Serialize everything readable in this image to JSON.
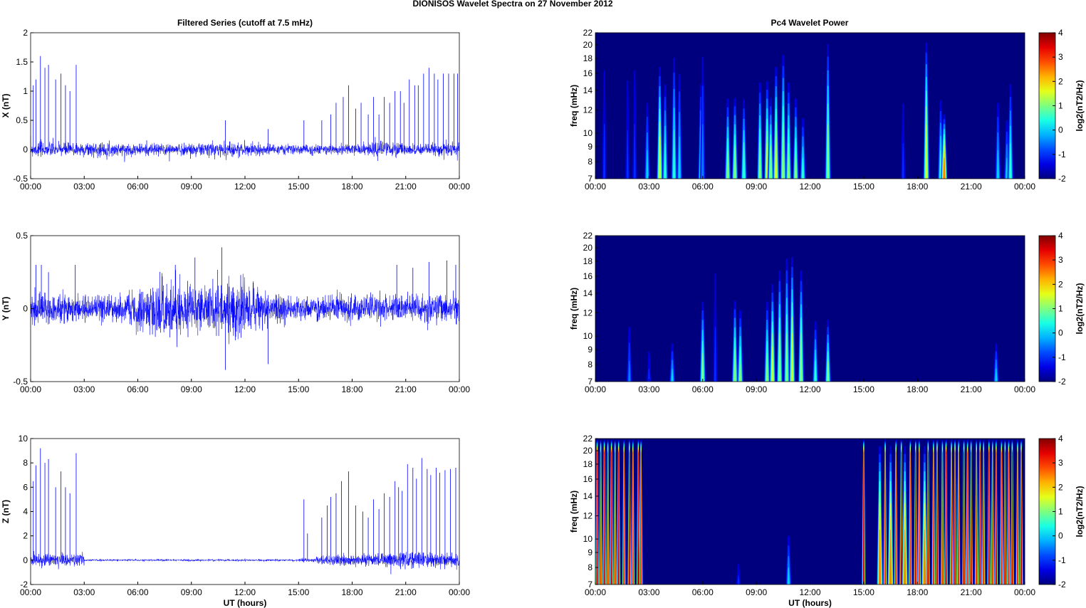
{
  "chart_data": {
    "title": "DIONISOS Wavelet Spectra on 27 November  2012",
    "left_title": "Filtered Series (cutoff at 7.5 mHz)",
    "right_title": "Pc4 Wavelet Power",
    "xlabel": "UT (hours)",
    "xticks": [
      "00:00",
      "03:00",
      "06:00",
      "09:00",
      "12:00",
      "15:00",
      "18:00",
      "21:00",
      "00:00"
    ],
    "series_color": "#0000ff",
    "series": [
      {
        "name": "X",
        "type": "line",
        "ylabel": "X (nT)",
        "ylim": [
          -0.5,
          2
        ],
        "yticks": [
          "-0.5",
          "0",
          "0.5",
          "1",
          "1.5",
          "2"
        ],
        "ytick_vals": [
          -0.5,
          0,
          0.5,
          1,
          1.5,
          2
        ],
        "noise_std_hourly": [
          0.06,
          0.06,
          0.06,
          0.06,
          0.05,
          0.05,
          0.05,
          0.05,
          0.05,
          0.06,
          0.07,
          0.06,
          0.05,
          0.04,
          0.04,
          0.04,
          0.04,
          0.04,
          0.05,
          0.07,
          0.05,
          0.04,
          0.05,
          0.06
        ],
        "spikes": [
          [
            0.15,
            1.1
          ],
          [
            0.3,
            1.2
          ],
          [
            0.55,
            1.6
          ],
          [
            0.8,
            1.4
          ],
          [
            1.0,
            1.45
          ],
          [
            1.4,
            1.2
          ],
          [
            1.7,
            1.3
          ],
          [
            1.95,
            1.1
          ],
          [
            2.2,
            1.0
          ],
          [
            2.55,
            1.45
          ],
          [
            10.9,
            0.5
          ],
          [
            13.3,
            0.35
          ],
          [
            15.3,
            0.5
          ],
          [
            16.3,
            0.5
          ],
          [
            16.8,
            0.6
          ],
          [
            17.1,
            0.8
          ],
          [
            17.5,
            0.9
          ],
          [
            17.8,
            1.1
          ],
          [
            18.2,
            0.7
          ],
          [
            18.5,
            0.8
          ],
          [
            18.9,
            0.6
          ],
          [
            19.2,
            0.9
          ],
          [
            19.5,
            0.6
          ],
          [
            19.8,
            0.9
          ],
          [
            20.1,
            0.8
          ],
          [
            20.4,
            1.0
          ],
          [
            20.7,
            1.0
          ],
          [
            20.9,
            0.8
          ],
          [
            21.2,
            1.2
          ],
          [
            21.5,
            1.1
          ],
          [
            21.7,
            1.1
          ],
          [
            22.0,
            1.3
          ],
          [
            22.3,
            1.4
          ],
          [
            22.6,
            1.3
          ],
          [
            22.8,
            1.2
          ],
          [
            23.1,
            1.3
          ],
          [
            23.4,
            1.3
          ],
          [
            23.7,
            1.3
          ],
          [
            23.9,
            1.3
          ]
        ]
      },
      {
        "name": "Y",
        "type": "line",
        "ylabel": "Y (nT)",
        "ylim": [
          -0.5,
          0.5
        ],
        "yticks": [
          "-0.5",
          "0",
          "0.5"
        ],
        "ytick_vals": [
          -0.5,
          0,
          0.5
        ],
        "noise_std_hourly": [
          0.05,
          0.05,
          0.045,
          0.045,
          0.045,
          0.06,
          0.08,
          0.09,
          0.09,
          0.07,
          0.08,
          0.1,
          0.07,
          0.05,
          0.04,
          0.04,
          0.04,
          0.045,
          0.045,
          0.045,
          0.045,
          0.045,
          0.05,
          0.05
        ],
        "spikes": [
          [
            0.3,
            0.3
          ],
          [
            0.6,
            0.3
          ],
          [
            1.0,
            0.25
          ],
          [
            2.5,
            0.3
          ],
          [
            8.1,
            0.3
          ],
          [
            9.2,
            0.35
          ],
          [
            10.7,
            0.42
          ],
          [
            10.9,
            -0.42
          ],
          [
            13.3,
            -0.38
          ],
          [
            20.5,
            0.3
          ],
          [
            21.4,
            0.28
          ],
          [
            22.3,
            0.32
          ],
          [
            23.3,
            0.33
          ],
          [
            23.8,
            0.3
          ]
        ]
      },
      {
        "name": "Z",
        "type": "line",
        "ylabel": "Z (nT)",
        "ylim": [
          -2,
          10
        ],
        "yticks": [
          "-2",
          "0",
          "2",
          "4",
          "6",
          "8",
          "10"
        ],
        "ytick_vals": [
          -2,
          0,
          2,
          4,
          6,
          8,
          10
        ],
        "noise_std_hourly": [
          0.25,
          0.25,
          0.25,
          0.05,
          0.04,
          0.04,
          0.04,
          0.04,
          0.04,
          0.04,
          0.04,
          0.04,
          0.04,
          0.04,
          0.04,
          0.08,
          0.2,
          0.25,
          0.25,
          0.25,
          0.3,
          0.3,
          0.3,
          0.3
        ],
        "spikes": [
          [
            0.15,
            6.5
          ],
          [
            0.3,
            7.8
          ],
          [
            0.55,
            9.2
          ],
          [
            0.8,
            8.0
          ],
          [
            1.0,
            8.3
          ],
          [
            1.4,
            6.0
          ],
          [
            1.7,
            7.3
          ],
          [
            1.95,
            6.0
          ],
          [
            2.2,
            5.5
          ],
          [
            2.55,
            8.8
          ],
          [
            15.3,
            5.0
          ],
          [
            15.5,
            2.2
          ],
          [
            16.3,
            3.5
          ],
          [
            16.6,
            4.5
          ],
          [
            16.8,
            5.2
          ],
          [
            17.1,
            5.5
          ],
          [
            17.4,
            6.5
          ],
          [
            17.8,
            7.3
          ],
          [
            18.2,
            4.5
          ],
          [
            18.6,
            4.0
          ],
          [
            18.9,
            3.5
          ],
          [
            19.2,
            5.0
          ],
          [
            19.5,
            4.2
          ],
          [
            19.8,
            5.5
          ],
          [
            20.1,
            5.2
          ],
          [
            20.4,
            6.5
          ],
          [
            20.6,
            6.0
          ],
          [
            20.8,
            5.7
          ],
          [
            21.1,
            7.9
          ],
          [
            21.4,
            7.6
          ],
          [
            21.6,
            6.7
          ],
          [
            21.9,
            8.4
          ],
          [
            22.2,
            7.5
          ],
          [
            22.4,
            7.0
          ],
          [
            22.7,
            7.6
          ],
          [
            22.9,
            7.2
          ],
          [
            23.2,
            7.4
          ],
          [
            23.5,
            7.5
          ],
          [
            23.8,
            7.6
          ]
        ]
      }
    ],
    "spectra": [
      {
        "name": "X",
        "type": "heatmap",
        "ylabel": "freq (mHz)",
        "yscale": "log",
        "ylim": [
          7,
          22
        ],
        "yticks": [
          "7",
          "8",
          "9",
          "10",
          "12",
          "14",
          "16",
          "18",
          "20",
          "22"
        ],
        "ytick_vals": [
          7,
          8,
          9,
          10,
          12,
          14,
          16,
          18,
          20,
          22
        ],
        "clim": [
          -2,
          4
        ],
        "colorbar_ticks": [
          "-2",
          "-1",
          "0",
          "1",
          "2",
          "3",
          "4"
        ],
        "colorbar_label": "log2(nT2/Hz)",
        "bursts_hour_power_topfreq": [
          [
            0.5,
            -1,
            22
          ],
          [
            1.8,
            -1,
            20
          ],
          [
            2.2,
            -1,
            22
          ],
          [
            2.9,
            0,
            14
          ],
          [
            3.6,
            1.5,
            18
          ],
          [
            3.9,
            0.5,
            16
          ],
          [
            4.4,
            0.5,
            20
          ],
          [
            4.7,
            0,
            18
          ],
          [
            5.9,
            0.5,
            16
          ],
          [
            6.0,
            -0.5,
            22
          ],
          [
            7.4,
            1,
            14
          ],
          [
            7.8,
            1.2,
            14
          ],
          [
            8.3,
            0.8,
            14
          ],
          [
            9.2,
            1,
            16
          ],
          [
            9.6,
            1.5,
            16
          ],
          [
            9.8,
            1.2,
            14
          ],
          [
            10.1,
            1.5,
            18
          ],
          [
            10.5,
            1.2,
            20
          ],
          [
            10.8,
            1,
            16
          ],
          [
            11.2,
            1,
            14
          ],
          [
            11.6,
            0.5,
            12
          ],
          [
            13.0,
            1,
            22
          ],
          [
            17.2,
            -1,
            16
          ],
          [
            18.5,
            1.5,
            22
          ],
          [
            19.3,
            0.5,
            14
          ],
          [
            19.5,
            2.5,
            12
          ],
          [
            22.5,
            0,
            14
          ],
          [
            23.0,
            0,
            12
          ],
          [
            23.2,
            0.5,
            16
          ]
        ]
      },
      {
        "name": "Y",
        "type": "heatmap",
        "ylabel": "freq (mHz)",
        "yscale": "log",
        "ylim": [
          7,
          22
        ],
        "yticks": [
          "7",
          "8",
          "9",
          "10",
          "12",
          "14",
          "16",
          "18",
          "20",
          "22"
        ],
        "ytick_vals": [
          7,
          8,
          9,
          10,
          12,
          14,
          16,
          18,
          20,
          22
        ],
        "clim": [
          -2,
          4
        ],
        "colorbar_ticks": [
          "-2",
          "-1",
          "0",
          "1",
          "2",
          "3",
          "4"
        ],
        "colorbar_label": "log2(nT2/Hz)",
        "bursts_hour_power_topfreq": [
          [
            1.9,
            -0.5,
            12
          ],
          [
            3.0,
            -1,
            10
          ],
          [
            4.3,
            0,
            10
          ],
          [
            6.0,
            1,
            14
          ],
          [
            6.7,
            -1,
            22
          ],
          [
            7.8,
            1.2,
            14
          ],
          [
            8.1,
            1,
            13
          ],
          [
            9.6,
            1,
            14
          ],
          [
            9.9,
            1.5,
            16
          ],
          [
            10.3,
            1.2,
            18
          ],
          [
            10.7,
            1,
            20
          ],
          [
            11.0,
            1.5,
            20
          ],
          [
            11.5,
            1.2,
            18
          ],
          [
            12.3,
            0.5,
            12
          ],
          [
            13.0,
            1,
            12
          ],
          [
            22.4,
            0,
            10
          ]
        ]
      },
      {
        "name": "Z",
        "type": "heatmap",
        "ylabel": "freq (mHz)",
        "yscale": "log",
        "ylim": [
          7,
          22
        ],
        "yticks": [
          "7",
          "8",
          "9",
          "10",
          "12",
          "14",
          "16",
          "18",
          "20",
          "22"
        ],
        "ytick_vals": [
          7,
          8,
          9,
          10,
          12,
          14,
          16,
          18,
          20,
          22
        ],
        "clim": [
          -2,
          4
        ],
        "colorbar_ticks": [
          "-2",
          "-1",
          "0",
          "1",
          "2",
          "3",
          "4"
        ],
        "colorbar_label": "log2(nT2/Hz)",
        "bursts_hour_power_topfreq": [
          [
            0.1,
            3.5,
            22
          ],
          [
            0.3,
            3,
            22
          ],
          [
            0.5,
            3.5,
            22
          ],
          [
            0.7,
            3,
            22
          ],
          [
            0.9,
            3.5,
            22
          ],
          [
            1.1,
            3,
            22
          ],
          [
            1.3,
            3.5,
            22
          ],
          [
            1.6,
            3,
            22
          ],
          [
            1.9,
            3.5,
            22
          ],
          [
            2.1,
            3,
            22
          ],
          [
            2.4,
            3.5,
            22
          ],
          [
            2.55,
            3,
            22
          ],
          [
            8.0,
            -1,
            9
          ],
          [
            10.8,
            0,
            11
          ],
          [
            15.0,
            3.5,
            22
          ],
          [
            15.9,
            2.5,
            22
          ],
          [
            16.2,
            3,
            22
          ],
          [
            16.5,
            2.5,
            22
          ],
          [
            16.8,
            3,
            22
          ],
          [
            17.1,
            3.5,
            22
          ],
          [
            17.3,
            2.5,
            22
          ],
          [
            17.6,
            3,
            22
          ],
          [
            17.9,
            3.5,
            22
          ],
          [
            18.1,
            3,
            22
          ],
          [
            18.4,
            2.5,
            22
          ],
          [
            18.6,
            3.5,
            22
          ],
          [
            18.9,
            3,
            22
          ],
          [
            19.1,
            3.5,
            22
          ],
          [
            19.4,
            3,
            22
          ],
          [
            19.6,
            3.5,
            22
          ],
          [
            19.9,
            3,
            22
          ],
          [
            20.1,
            3.5,
            22
          ],
          [
            20.3,
            3,
            22
          ],
          [
            20.6,
            3.5,
            22
          ],
          [
            20.8,
            3,
            22
          ],
          [
            21.0,
            3.5,
            22
          ],
          [
            21.3,
            3,
            22
          ],
          [
            21.5,
            3.5,
            22
          ],
          [
            21.7,
            3,
            22
          ],
          [
            22.0,
            3.5,
            22
          ],
          [
            22.2,
            3,
            22
          ],
          [
            22.4,
            3.5,
            22
          ],
          [
            22.7,
            3,
            22
          ],
          [
            22.9,
            3.5,
            22
          ],
          [
            23.1,
            3,
            22
          ],
          [
            23.3,
            3.5,
            22
          ],
          [
            23.6,
            3,
            22
          ],
          [
            23.8,
            3.5,
            22
          ]
        ]
      }
    ]
  }
}
